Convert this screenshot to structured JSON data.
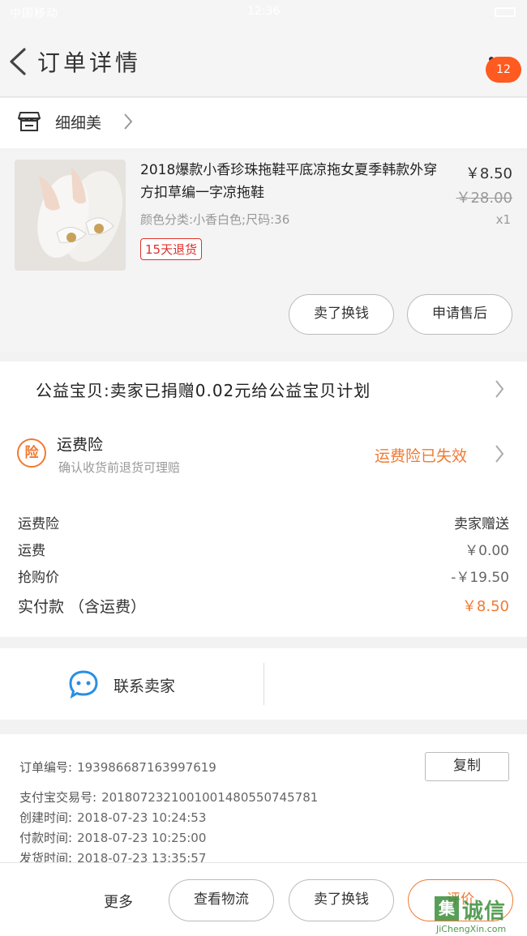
{
  "status_bar": {
    "left": "中国移动",
    "time": "12:36"
  },
  "header": {
    "title": "订单详情",
    "badge": "12"
  },
  "store": {
    "name": "细细美"
  },
  "product": {
    "name": "2018爆款小香珍珠拖鞋平底凉拖女夏季韩款外穿方扣草编一字凉拖鞋",
    "attributes": "颜色分类:小香白色;尺码:36",
    "tag": "15天退货",
    "price": "￥8.50",
    "original_price": "￥28.00",
    "quantity": "x1",
    "buttons": [
      "卖了换钱",
      "申请售后"
    ]
  },
  "charity": {
    "text": "公益宝贝:卖家已捐赠0.02元给公益宝贝计划"
  },
  "insurance": {
    "icon_text": "险",
    "title": "运费险",
    "subtitle": "确认收货前退货可理赔",
    "status": "运费险已失效"
  },
  "fees": [
    {
      "label": "运费险",
      "value": "卖家赠送"
    },
    {
      "label": "运费",
      "value": "￥0.00"
    },
    {
      "label": "抢购价",
      "value": "-￥19.50"
    },
    {
      "label": "实付款 （含运费）",
      "value": "￥8.50"
    }
  ],
  "contact": {
    "label": "联系卖家"
  },
  "order_info": {
    "copy_label": "复制",
    "rows": [
      {
        "label": "订单编号:",
        "value": "193986687163997619"
      },
      {
        "label": "支付宝交易号:",
        "value": "2018072321001001480550745781"
      },
      {
        "label": "创建时间:",
        "value": "2018-07-23 10:24:53"
      },
      {
        "label": "付款时间:",
        "value": "2018-07-23 10:25:00"
      },
      {
        "label": "发货时间:",
        "value": "2018-07-23 13:35:57"
      }
    ]
  },
  "bottom_bar": {
    "more": "更多",
    "buttons": [
      "查看物流",
      "卖了换钱",
      "评价"
    ]
  },
  "watermark": {
    "logo": "集",
    "text": "诚信",
    "url": "JiChengXin.com"
  },
  "colors": {
    "accent": "#f07a32",
    "badge": "#ff5a1f",
    "tag_red": "#e0302a"
  },
  "icons": [
    "back-icon",
    "more-icon",
    "store-icon",
    "chevron-right-icon",
    "chat-icon"
  ]
}
